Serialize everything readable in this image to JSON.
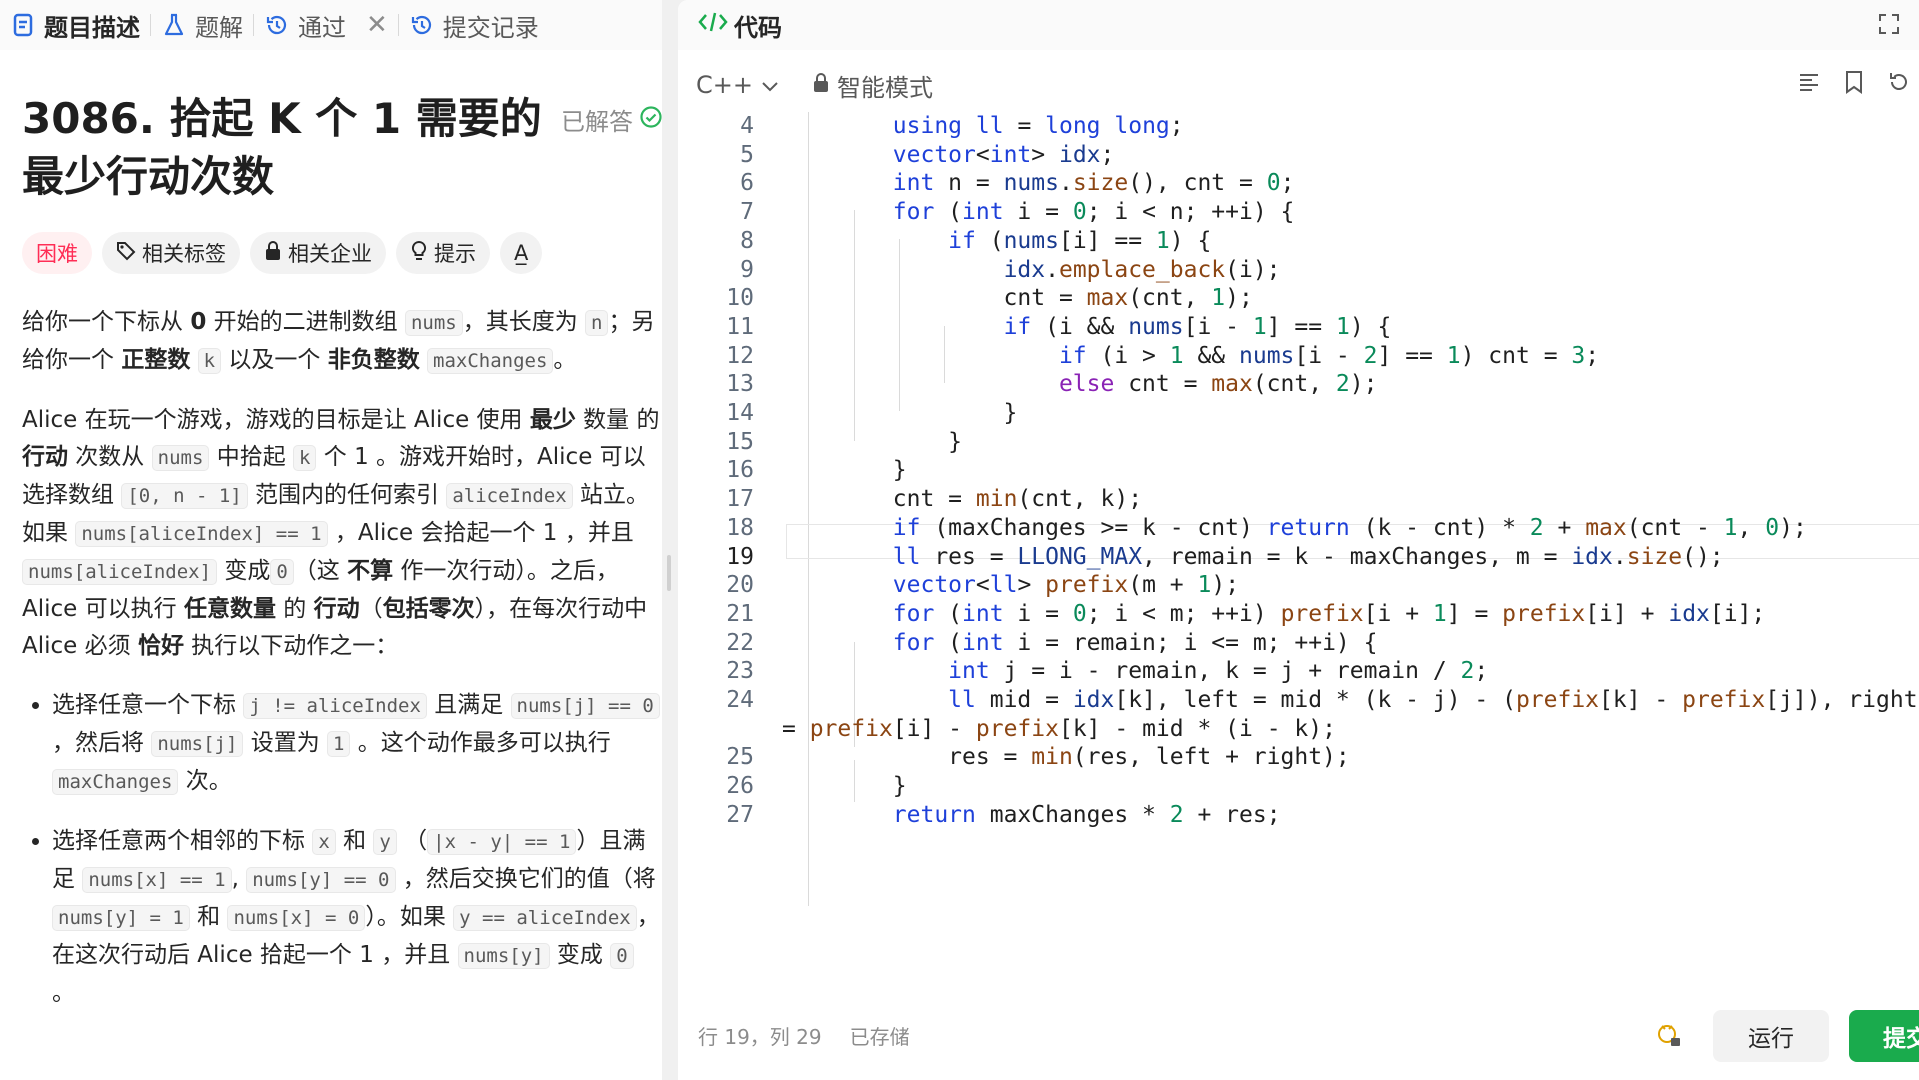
{
  "tabs": [
    {
      "label": "题目描述",
      "icon": "document-icon"
    },
    {
      "label": "题解",
      "icon": "flask-icon"
    },
    {
      "label": "通过",
      "icon": "history-icon"
    },
    {
      "label": "提交记录",
      "icon": "history-icon"
    }
  ],
  "problem": {
    "title": "3086. 拾起 K 个 1 需要的最少行动次数",
    "status": "已解答",
    "difficulty": "困难",
    "chips": [
      "相关标签",
      "相关企业",
      "提示"
    ],
    "font_chip": "A̲"
  },
  "description": {
    "p1": {
      "t1": "给你一个下标从 ",
      "b1": "0",
      "t2": " 开始的二进制数组 ",
      "c1": "nums",
      "t3": "，其长度为 ",
      "c2": "n",
      "t4": "；另给你一个 ",
      "b2": "正整数",
      "t5": " ",
      "c3": "k",
      "t6": " 以及一个 ",
      "b3": "非负整数",
      "t7": " ",
      "c4": "maxChanges",
      "t8": "。"
    },
    "p2": {
      "t1": "Alice 在玩一个游戏，游戏的目标是让 Alice 使用 ",
      "b1": "最少",
      "t2": " 数量 的 ",
      "b2": "行动",
      "t3": " 次数从 ",
      "c1": "nums",
      "t4": " 中拾起 ",
      "c2": "k",
      "t5": " 个 1 。游戏开始时，Alice 可以选择数组 ",
      "c3": "[0, n - 1]",
      "t6": " 范围内的任何索引 ",
      "c4": "aliceIndex",
      "t7": " 站立。如果 ",
      "c5": "nums[aliceIndex] == 1",
      "t8": " ，Alice 会拾起一个 1 ，并且 ",
      "c6": "nums[aliceIndex]",
      "t9": " 变成",
      "c7": "0",
      "t10": "（这 ",
      "b3": "不算",
      "t11": " 作一次行动）。之后，Alice 可以执行 ",
      "b4": "任意数量",
      "t12": " 的 ",
      "b5": "行动",
      "t13": "（",
      "b6": "包括零次",
      "t14": "），在每次行动中 Alice 必须 ",
      "b7": "恰好",
      "t15": " 执行以下动作之一："
    },
    "li1": {
      "t1": "选择任意一个下标 ",
      "c1": "j != aliceIndex",
      "t2": " 且满足 ",
      "c2": "nums[j] == 0",
      "t3": " ，然后将 ",
      "c3": "nums[j]",
      "t4": " 设置为 ",
      "c4": "1",
      "t5": " 。这个动作最多可以执行 ",
      "c5": "maxChanges",
      "t6": " 次。"
    },
    "li2": {
      "t1": "选择任意两个相邻的下标 ",
      "c1": "x",
      "t2": " 和 ",
      "c2": "y",
      "t3": " （",
      "c3": "|x - y| == 1",
      "t4": "）且满足 ",
      "c4": "nums[x] == 1",
      "t5": ", ",
      "c5": "nums[y] == 0",
      "t6": " ，然后交换它们的值（将 ",
      "c6": "nums[y] = 1",
      "t7": " 和 ",
      "c7": "nums[x] = 0",
      "t8": "）。如果 ",
      "c8": "y == aliceIndex",
      "t9": "，在这次行动后 Alice 拾起一个 1 ，并且 ",
      "c9": "nums[y]",
      "t10": " 变成 ",
      "c10": "0",
      "t11": " 。"
    }
  },
  "code_panel": {
    "title": "代码",
    "language": "C++",
    "mode": "智能模式"
  },
  "code_lines": [
    {
      "n": "4",
      "text": "        using ll = long long;"
    },
    {
      "n": "5",
      "text": "        vector<int> idx;"
    },
    {
      "n": "6",
      "text": "        int n = nums.size(), cnt = 0;"
    },
    {
      "n": "7",
      "text": "        for (int i = 0; i < n; ++i) {"
    },
    {
      "n": "8",
      "text": "            if (nums[i] == 1) {"
    },
    {
      "n": "9",
      "text": "                idx.emplace_back(i);"
    },
    {
      "n": "10",
      "text": "                cnt = max(cnt, 1);"
    },
    {
      "n": "11",
      "text": "                if (i && nums[i - 1] == 1) {"
    },
    {
      "n": "12",
      "text": "                    if (i > 1 && nums[i - 2] == 1) cnt = 3;"
    },
    {
      "n": "13",
      "text": "                    else cnt = max(cnt, 2);"
    },
    {
      "n": "14",
      "text": "                }"
    },
    {
      "n": "15",
      "text": "            }"
    },
    {
      "n": "16",
      "text": "        }"
    },
    {
      "n": "17",
      "text": "        cnt = min(cnt, k);"
    },
    {
      "n": "18",
      "text": "        if (maxChanges >= k - cnt) return (k - cnt) * 2 + max(cnt - 1, 0);"
    },
    {
      "n": "19",
      "text": "        ll res = LLONG_MAX, remain = k - maxChanges, m = idx.size();"
    },
    {
      "n": "20",
      "text": "        vector<ll> prefix(m + 1);"
    },
    {
      "n": "21",
      "text": "        for (int i = 0; i < m; ++i) prefix[i + 1] = prefix[i] + idx[i];"
    },
    {
      "n": "22",
      "text": "        for (int i = remain; i <= m; ++i) {"
    },
    {
      "n": "23",
      "text": "            int j = i - remain, k = j + remain / 2;"
    },
    {
      "n": "24",
      "text": "            ll mid = idx[k], left = mid * (k - j) - (prefix[k] - prefix[j]), right"
    },
    {
      "n": "",
      "text": "= prefix[i] - prefix[k] - mid * (i - k);"
    },
    {
      "n": "25",
      "text": "            res = min(res, left + right);"
    },
    {
      "n": "26",
      "text": "        }"
    },
    {
      "n": "27",
      "text": "        return maxChanges * 2 + res;"
    }
  ],
  "status": {
    "position": "行 19，列 29",
    "saved": "已存储",
    "run": "运行",
    "submit": "提交"
  },
  "colors": {
    "keyword": "#1e40d9",
    "keyword2": "#8a23b5",
    "function": "#8b4513",
    "number": "#0a8a5a",
    "variable": "#1a3b8f",
    "difficulty": "#ff2d55",
    "submit": "#1aab4d",
    "solved": "#2db55d"
  }
}
